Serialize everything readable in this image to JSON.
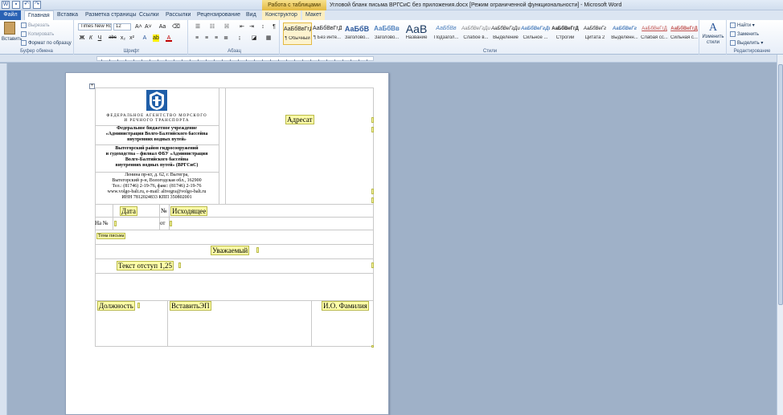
{
  "titlebar": {
    "context_tab": "Работа с таблицами",
    "window_title": "Угловой бланк письма ВРГСиС без приложения.docx [Режим ограниченной функциональности] - Microsoft Word"
  },
  "tabs": [
    {
      "label": "Файл"
    },
    {
      "label": "Главная"
    },
    {
      "label": "Вставка"
    },
    {
      "label": "Разметка страницы"
    },
    {
      "label": "Ссылки"
    },
    {
      "label": "Рассылки"
    },
    {
      "label": "Рецензирование"
    },
    {
      "label": "Вид"
    },
    {
      "label": "Конструктор"
    },
    {
      "label": "Макет"
    }
  ],
  "ribbon": {
    "clipboard": {
      "paste": "Вставить",
      "cut": "Вырезать",
      "copy": "Копировать",
      "format_painter": "Формат по образцу",
      "group": "Буфер обмена"
    },
    "font": {
      "font_name": "Times New Ro",
      "font_size": "12",
      "bold": "Ж",
      "italic": "К",
      "underline": "Ч",
      "grow": "A˄",
      "shrink": "A˅",
      "case": "Aa",
      "strike": "abc",
      "sub": "x₂",
      "sup": "x²",
      "group": "Шрифт"
    },
    "paragraph": {
      "group": "Абзац",
      "pilcrow": "¶"
    },
    "styles": {
      "group": "Стили",
      "change_styles": "Изменить стили",
      "items": [
        {
          "sample": "АаБбВвГгД",
          "name": "¶ Обычный"
        },
        {
          "sample": "АаБбВвГгД",
          "name": "¶ Без инте..."
        },
        {
          "sample": "АаБбВ",
          "name": "Заголово..."
        },
        {
          "sample": "АаБбВв",
          "name": "Заголово..."
        },
        {
          "sample": "АаВ",
          "name": "Название"
        },
        {
          "sample": "АаБбВв",
          "name": "Подзагол..."
        },
        {
          "sample": "АаБбВеГгДи",
          "name": "Слабое в..."
        },
        {
          "sample": "АаБбВеГгДи",
          "name": "Выделение"
        },
        {
          "sample": "АаБбВеГгДи",
          "name": "Сильное ..."
        },
        {
          "sample": "АаБбВеГгД",
          "name": "Строгий"
        },
        {
          "sample": "АаБбВеГг",
          "name": "Цитата 2"
        },
        {
          "sample": "АаБбВеГг",
          "name": "Выделенн..."
        },
        {
          "sample": "АаБбВеГгД",
          "name": "Слабая сс..."
        },
        {
          "sample": "АаБбВеГгД",
          "name": "Сильная с..."
        }
      ]
    },
    "editing": {
      "find": "Найти",
      "replace": "Заменить",
      "select": "Выделить",
      "group": "Редактирование"
    }
  },
  "document": {
    "agency_line1": "ФЕДЕРАЛЬНОЕ АГЕНТСТВО МОРСКОГО",
    "agency_line2": "И РЕЧНОГО ТРАНСПОРТА",
    "org1_line1": "Федеральное бюджетное учреждение",
    "org1_line2": "«Администрация Волго-Балтийского бассейна",
    "org1_line3": "внутренних водных путей»",
    "org2_line1": "Вытегорский район гидросооружений",
    "org2_line2": "и судоходства – филиал ФБУ «Администрация",
    "org2_line3": "Волго-Балтийского бассейна",
    "org2_line4": "внутренних водных путей» (ВРГСиС)",
    "addr_line1": "Ленина пр-кт, д. 62, г. Вытегра,",
    "addr_line2": "Вытегорский р-н, Вологодская обл., 162900",
    "addr_line3": "Тел.: (81746) 2-19-76, факс: (81746) 2-19-76",
    "addr_line4": "www.volgo-balt.ru, e-mail: altvegra@volgo-balt.ru",
    "addr_line5": "ИНН 7812024833 КПП 350802001",
    "addressee": "Адресат",
    "date": "Дата",
    "number_sign": "№",
    "outgoing": "Исходящее",
    "in_reply_to": "На №",
    "from": "от",
    "subject": "Тема письма",
    "greeting": "Уважаемый",
    "body": "Текст отступ 1,25",
    "position": "Должность",
    "signature": "ВставитьЭП",
    "signer_name": "И.О. Фамилия"
  }
}
